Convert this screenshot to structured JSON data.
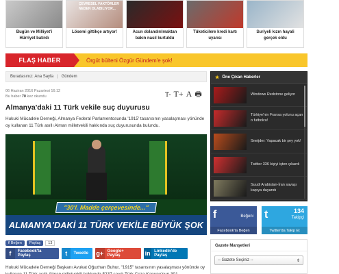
{
  "top_news": [
    {
      "title": "Bugün ve Milliyet'i Hürriyet batırdı",
      "color_a": "#c9c9c9",
      "color_b": "#8a8a8a",
      "img_text": ""
    },
    {
      "title": "Lösemi gittikçe artıyor!",
      "color_a": "#e8e2e0",
      "color_b": "#b58d7e",
      "img_text": "ÇEVRESEL FAKTÖRLER NEDEN OLABILIYOR..."
    },
    {
      "title": "Acun dolandırılmaktan bakın nasıl kurtuldu",
      "color_a": "#2a2a2a",
      "color_b": "#7a1010",
      "img_text": ""
    },
    {
      "title": "Tüketicilere kredi kartı uyarısı",
      "color_a": "#6b6b6b",
      "color_b": "#c0392b",
      "img_text": ""
    },
    {
      "title": "Suriyeli kızın hayali gerçek oldu",
      "color_a": "#9ab5c9",
      "color_b": "#e2e2e2",
      "img_text": ""
    }
  ],
  "flash": {
    "label": "FLAŞ HABER",
    "text": "Örgüt bülteni Özgür Gündem'e şok!"
  },
  "breadcrumb": {
    "prefix": "Buradasınız:",
    "home": "Ana Sayfa",
    "section": "Gündem"
  },
  "article": {
    "date": "06 Haziran 2016 Pazartesi 16:12",
    "views_prefix": "Bu haber",
    "views_count": "70",
    "views_suffix": "kez okundu",
    "title": "Almanya'daki 11 Türk vekile suç duyurusu",
    "lead": "Hukuki Mücadele Derneği, Almanya Federal Parlamentosunda '1915' tasarısının yasalaşması yönünde oy kullanan 11 Türk asıllı Alman milletvekili hakkında suç duyurusunda bulundu.",
    "image_banner_top": "\"30'l. Madde çerçevesinde...\"",
    "image_banner_main": "ALMANYA'DAKİ 11 TÜRK VEKİLE BÜYÜK ŞOK",
    "body": "Hukuki Mücadele Derneği Başkanı Avukat Oğuzhan Buhur, \"1915\" tasarısının yasalaşması yönünde oy kullanan 11 Türk asıllı Alman milletvekili hakkında 5237 sayılı Türk Ceza Kanunu'nun 301."
  },
  "font_tools": {
    "smaller": "T-",
    "larger": "T+",
    "reset": "A",
    "print": "🖶"
  },
  "share": {
    "like_label": "Beğen",
    "share_label": "Paylaş",
    "count": "13",
    "buttons": [
      {
        "key": "fb",
        "icon": "f",
        "label": "Facebook'ta Paylaş"
      },
      {
        "key": "tw",
        "icon": "t",
        "label": "Tweetle"
      },
      {
        "key": "gp",
        "icon": "g+",
        "label": "Google+ Paylaş"
      },
      {
        "key": "li",
        "icon": "in",
        "label": "LinkedIn'de Paylaş"
      }
    ]
  },
  "sidebar": {
    "title": "Öne Çıkan Haberler",
    "items": [
      {
        "title": "Windows Redstone geliyor",
        "thumb": "#a81b1b"
      },
      {
        "title": "Türkiye'nin Fransa yolunu açan o futbolcu!",
        "thumb": "#c62b2b"
      },
      {
        "title": "Sneijder: Yapacak bir şey yok!",
        "thumb": "#b94c1c"
      },
      {
        "title": "Twitter 336 kişiyi işten çıkardı",
        "thumb": "#d03030"
      },
      {
        "title": "Suudi Arabistan-İran savaşı kapıya dayandı",
        "thumb": "#7f7a5e"
      }
    ]
  },
  "social": {
    "facebook": {
      "label": "Beğeni",
      "footer": "Facebook'ta Beğen",
      "icon": "f"
    },
    "twitter": {
      "count": "134",
      "label": "Takipçi",
      "footer": "Twitter'da Takip Et",
      "icon": "t"
    }
  },
  "gazete": {
    "title": "Gazete Manşetleri",
    "selected": "-- Gazete Seçiniz --"
  }
}
